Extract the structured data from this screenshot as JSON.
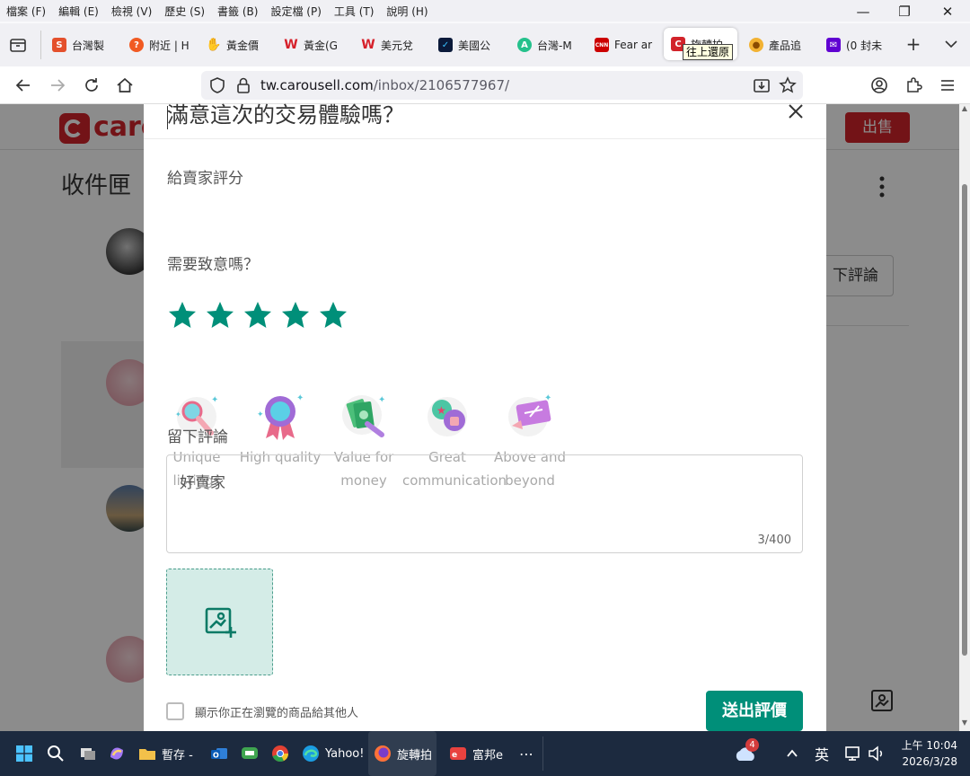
{
  "menu": [
    "檔案 (F)",
    "編輯 (E)",
    "檢視 (V)",
    "歷史 (S)",
    "書籤 (B)",
    "設定檔 (P)",
    "工具 (T)",
    "說明 (H)"
  ],
  "window_controls": {
    "minimize": "—",
    "restore": "❐",
    "close": "✕"
  },
  "tabs": [
    {
      "label": "台灣製",
      "color": "#e4502c",
      "glyph": "S"
    },
    {
      "label": "附近 | H",
      "color": "#f15a22",
      "glyph": "?"
    },
    {
      "label": "黃金價",
      "color": "#c9a062",
      "glyph": "✋"
    },
    {
      "label": "黃金(G",
      "color": "#ffffff",
      "glyph": "W"
    },
    {
      "label": "美元兌",
      "color": "#ffffff",
      "glyph": "W"
    },
    {
      "label": "美國公",
      "color": "#0b1a3a",
      "glyph": "✓"
    },
    {
      "label": "台灣-M",
      "color": "#25c18c",
      "glyph": "A"
    },
    {
      "label": "Fear ar",
      "color": "#cc0000",
      "glyph": "CNN"
    },
    {
      "label": "旋轉拍",
      "color": "#d2232a",
      "glyph": "C"
    },
    {
      "label": "產品追",
      "color": "#f2b233",
      "glyph": "●"
    },
    {
      "label": "(0 封未",
      "color": "#6001d2",
      "glyph": "✉"
    }
  ],
  "tooltip": "往上還原",
  "url": {
    "host": "tw.carousell.com",
    "path": "/inbox/2106577967/"
  },
  "page": {
    "brand": "caro",
    "sell_button": "出售",
    "inbox_title": "收件匣",
    "review_button": "下評論"
  },
  "modal": {
    "title": "滿意這次的交易體驗嗎？",
    "rate_label": "給賣家評分",
    "rating": 5,
    "rating_max": 5,
    "star_color": "#008f79",
    "compliment_label": "需要致意嗎？",
    "compliments": [
      {
        "label": "Unique listings",
        "icon": "magnifier-icon"
      },
      {
        "label": "High quality",
        "icon": "ribbon-badge-icon"
      },
      {
        "label": "Value for money",
        "icon": "money-icon"
      },
      {
        "label": "Great communication",
        "icon": "chat-thumbs-up-icon"
      },
      {
        "label": "Above and beyond",
        "icon": "ticket-icon"
      }
    ],
    "comment_label": "留下評論",
    "comment_value": "好賣家",
    "char_count": "3/400",
    "checkbox_label": "顯示你正在瀏覽的商品給其他人",
    "submit_label": "送出評價",
    "submit_color": "#008f79"
  },
  "taskbar": {
    "items": [
      {
        "label": "暫存 -",
        "icon": "folder-icon"
      },
      {
        "label": "Yahoo!",
        "icon": "edge-icon"
      },
      {
        "label": "旋轉拍",
        "icon": "firefox-icon"
      },
      {
        "label": "富邦e",
        "icon": "fubon-icon"
      }
    ],
    "weather_badge": "4",
    "ime": "英",
    "time": "上午 10:04",
    "date": "2026/3/28"
  }
}
